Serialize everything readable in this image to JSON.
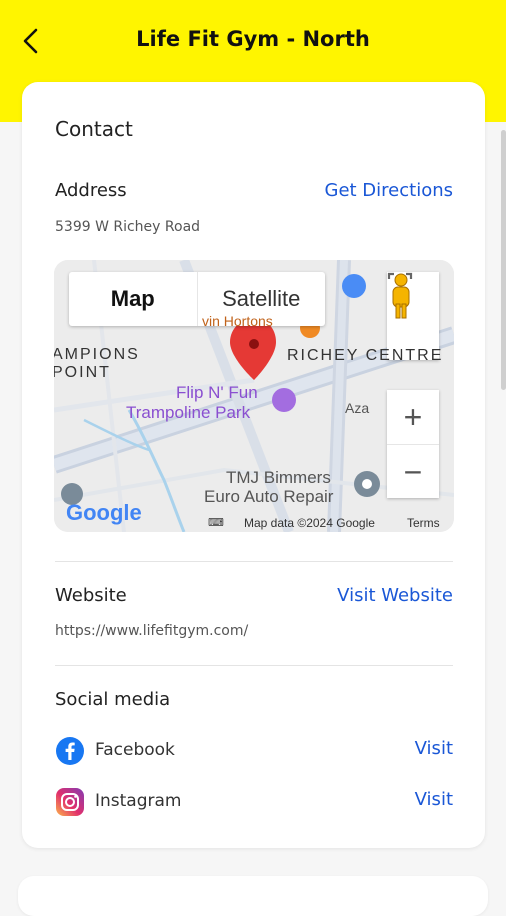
{
  "header": {
    "title": "Life Fit Gym - North"
  },
  "contact": {
    "heading": "Contact",
    "address_label": "Address",
    "get_directions": "Get Directions",
    "address": "5399 W Richey Road",
    "map": {
      "type_map": "Map",
      "type_satellite": "Satellite",
      "zoom_in": "+",
      "zoom_out": "−",
      "poi1": "Flip N' Fun",
      "poi1b": "Trampoline Park",
      "poi2": "TMJ Bimmers",
      "poi2b": "Euro Auto Repair",
      "place1": "RICHEY CENTRE",
      "place2a": "AMPIONS",
      "place2b": "POINT",
      "partial1": "Aza",
      "partial2": "vin Hortons",
      "google": "Google",
      "attribution": "Map data ©2024 Google",
      "terms": "Terms"
    },
    "website_label": "Website",
    "visit_website": "Visit Website",
    "website_url": "https://www.lifefitgym.com/",
    "social_heading": "Social media",
    "social": [
      {
        "name": "Facebook",
        "action": "Visit",
        "icon": "facebook-icon",
        "color": "#1877f2"
      },
      {
        "name": "Instagram",
        "action": "Visit",
        "icon": "instagram-icon",
        "color": "#d6249f"
      }
    ]
  },
  "colors": {
    "accent": "#fff500",
    "link": "#1a57d6"
  }
}
